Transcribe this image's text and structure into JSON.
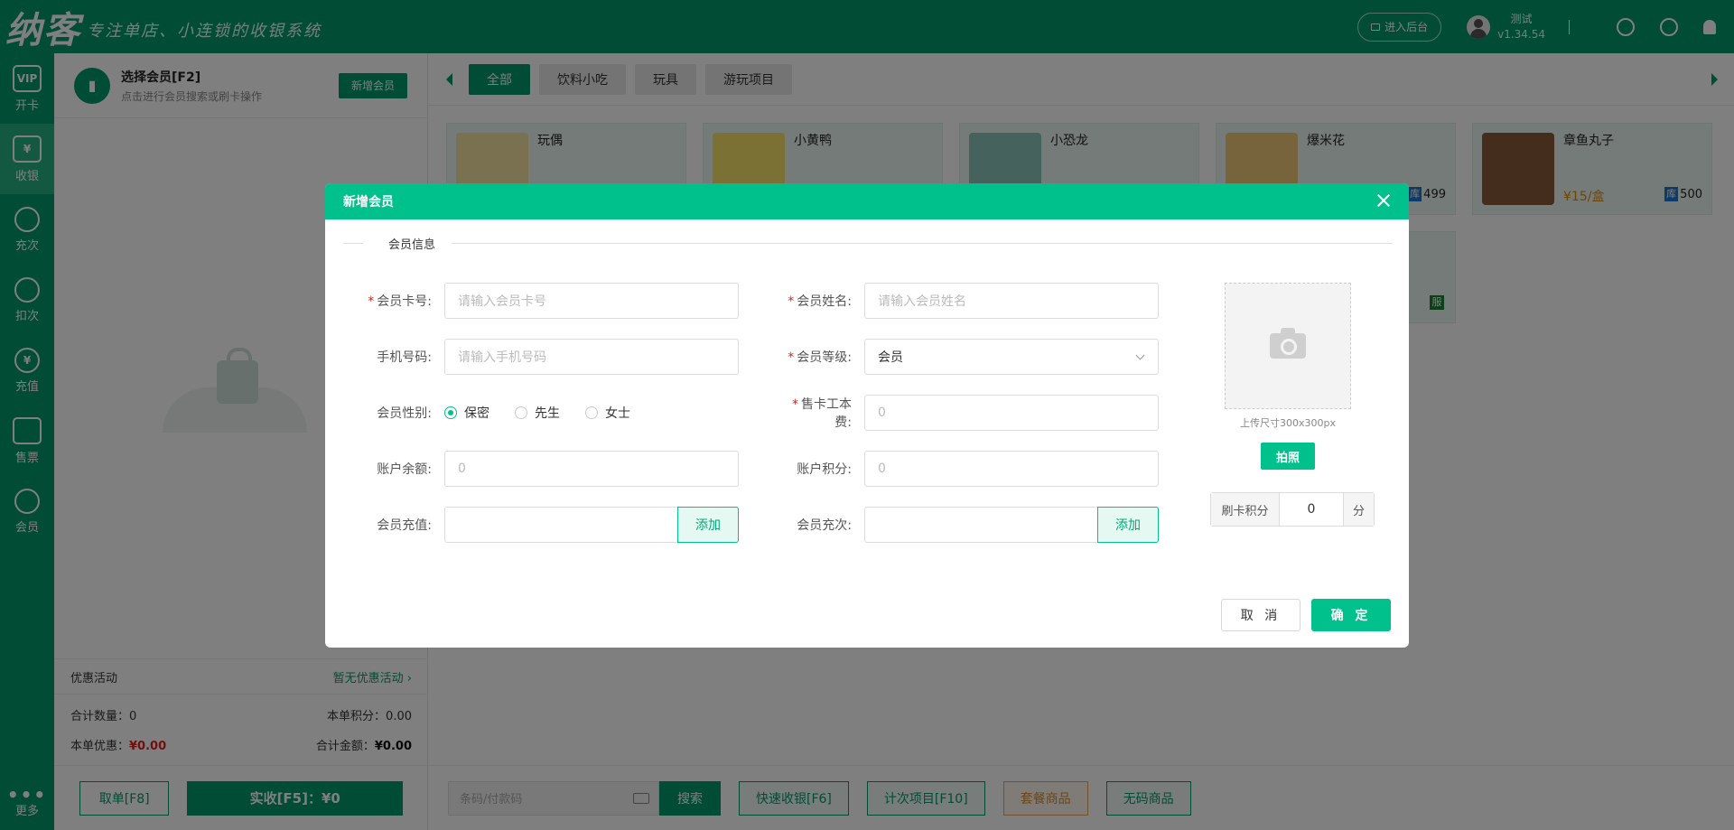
{
  "header": {
    "logo": "纳客",
    "slogan": "专注单店、小连锁的收银系统",
    "admin_button": "进入后台",
    "user_name": "测试",
    "version": "v1.34.54"
  },
  "sidebar": {
    "items": [
      {
        "label": "开卡",
        "icon": "vip-card-icon",
        "glyph": "VIP"
      },
      {
        "label": "收银",
        "icon": "cashier-icon",
        "glyph": "¥"
      },
      {
        "label": "充次",
        "icon": "recharge-count-icon",
        "glyph": ""
      },
      {
        "label": "扣次",
        "icon": "deduct-count-icon",
        "glyph": ""
      },
      {
        "label": "充值",
        "icon": "recharge-icon",
        "glyph": "¥"
      },
      {
        "label": "售票",
        "icon": "ticket-icon",
        "glyph": ""
      },
      {
        "label": "会员",
        "icon": "member-icon",
        "glyph": ""
      }
    ],
    "more_label": "更多"
  },
  "left_panel": {
    "member_title": "选择会员[F2]",
    "member_subtitle": "点击进行会员搜索或刷卡操作",
    "new_member_button": "新增会员",
    "promo_label": "优惠活动",
    "promo_value": "暂无优惠活动 ›",
    "total_qty_label": "合计数量：",
    "total_qty_value": "0",
    "order_points_label": "本单积分：",
    "order_points_value": "0.00",
    "discount_label": "本单优惠：",
    "discount_value": "¥0.00",
    "total_amount_label": "合计金额：",
    "total_amount_value": "¥0.00",
    "cancel_order_button": "取单[F8]",
    "pay_button": "实收[F5]：¥0"
  },
  "main": {
    "tabs": [
      "全部",
      "饮料小吃",
      "玩具",
      "游玩项目"
    ],
    "active_tab": 0,
    "products": [
      {
        "name": "玩偶",
        "price": "",
        "stock": "",
        "color": "#e8c230"
      },
      {
        "name": "小黄鸭",
        "price": "",
        "stock": "",
        "color": "#f5d000"
      },
      {
        "name": "小恐龙",
        "price": "",
        "stock": "",
        "color": "#4a9a8a"
      },
      {
        "name": "爆米花",
        "price": "",
        "stock": "499",
        "color": "#d9a040"
      },
      {
        "name": "章鱼丸子",
        "price": "¥15/盒",
        "stock": "500",
        "color": "#8a5a3a"
      }
    ],
    "stock_badge": "库",
    "service_badge": "服",
    "barcode_placeholder": "条码/付款码",
    "search_button": "搜索",
    "quick_pay_button": "快速收银[F6]",
    "count_items_button": "计次项目[F10]",
    "package_button": "套餐商品",
    "no_code_button": "无码商品"
  },
  "dialog": {
    "title": "新增会员",
    "section": "会员信息",
    "fields": {
      "card_no_label": "会员卡号:",
      "card_no_placeholder": "请输入会员卡号",
      "name_label": "会员姓名:",
      "name_placeholder": "请输入会员姓名",
      "phone_label": "手机号码:",
      "phone_placeholder": "请输入手机号码",
      "level_label": "会员等级:",
      "level_value": "会员",
      "gender_label": "会员性别:",
      "gender_options": [
        "保密",
        "先生",
        "女士"
      ],
      "gender_selected": "保密",
      "card_fee_label": "售卡工本费:",
      "card_fee_value": "0",
      "balance_label": "账户余额:",
      "balance_value": "0",
      "points_label": "账户积分:",
      "points_value": "0",
      "recharge_label": "会员充值:",
      "recharge_count_label": "会员充次:",
      "add_button": "添加"
    },
    "upload_hint": "上传尺寸300x300px",
    "photo_button": "拍照",
    "swipe_points_label": "刷卡积分",
    "swipe_points_value": "0",
    "swipe_points_unit": "分",
    "cancel_button": "取 消",
    "ok_button": "确 定"
  }
}
